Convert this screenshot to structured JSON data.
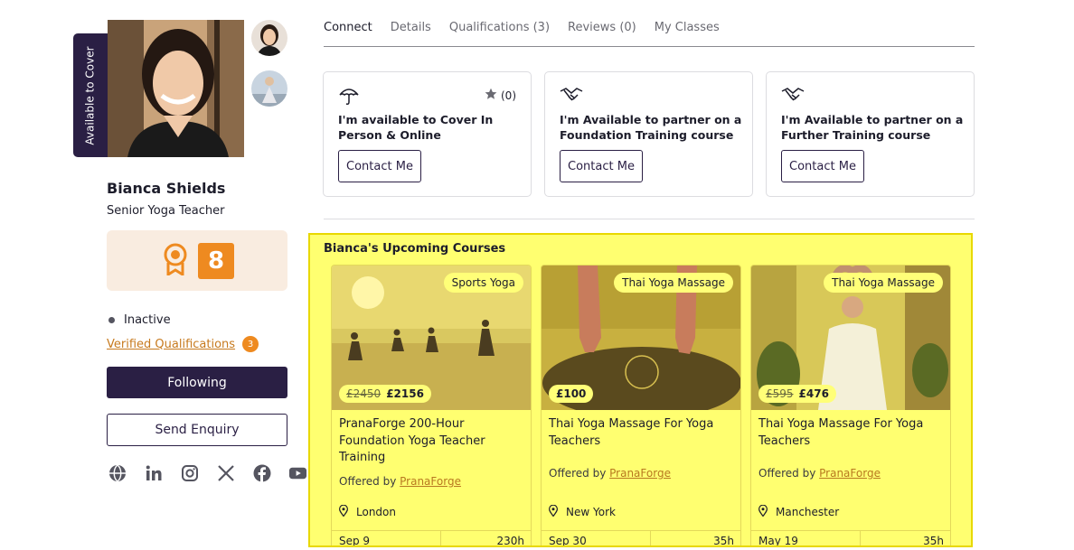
{
  "profile": {
    "cover_label": "Available to Cover",
    "name": "Bianca Shields",
    "title": "Senior Yoga Teacher",
    "badge_number": "8",
    "status": "Inactive",
    "verified_label": "Verified Qualifications",
    "verified_count": "3",
    "follow_label": "Following",
    "enquiry_label": "Send Enquiry",
    "socials": [
      "globe-icon",
      "linkedin-icon",
      "instagram-icon",
      "x-icon",
      "facebook-icon",
      "youtube-icon"
    ]
  },
  "tabs": [
    {
      "label": "Connect",
      "active": true
    },
    {
      "label": "Details"
    },
    {
      "label": "Qualifications (3)"
    },
    {
      "label": "Reviews (0)"
    },
    {
      "label": "My Classes"
    }
  ],
  "connect_cards": [
    {
      "icon": "umbrella-icon",
      "rating": "(0)",
      "text": "I'm available to Cover In Person & Online",
      "button": "Contact Me"
    },
    {
      "icon": "handshake-icon",
      "text": "I'm Available to partner on a Foundation Training course",
      "button": "Contact Me"
    },
    {
      "icon": "handshake-icon",
      "text": "I'm Available to partner on a Further Training course",
      "button": "Contact Me"
    }
  ],
  "upcoming": {
    "title": "Bianca's Upcoming Courses",
    "courses": [
      {
        "category": "Sports Yoga",
        "old_price": "£2450",
        "price": "£2156",
        "title": "PranaForge 200-Hour Foundation Yoga Teacher Training",
        "offered_by_label": "Offered by",
        "provider": "PranaForge",
        "location": "London",
        "date": "Sep 9",
        "duration": "230h"
      },
      {
        "category": "Thai Yoga Massage",
        "old_price": "",
        "price": "£100",
        "title": "Thai Yoga Massage For Yoga Teachers",
        "offered_by_label": "Offered by",
        "provider": "PranaForge",
        "location": "New York",
        "date": "Sep 30",
        "duration": "35h"
      },
      {
        "category": "Thai Yoga Massage",
        "old_price": "£595",
        "price": "£476",
        "title": "Thai Yoga Massage For Yoga Teachers",
        "offered_by_label": "Offered by",
        "provider": "PranaForge",
        "location": "Manchester",
        "date": "May 19",
        "duration": "35h"
      }
    ]
  },
  "colors": {
    "brand_dark": "#2a1f44",
    "accent_orange": "#ee8a20",
    "highlight_yellow": "#ffff70"
  }
}
